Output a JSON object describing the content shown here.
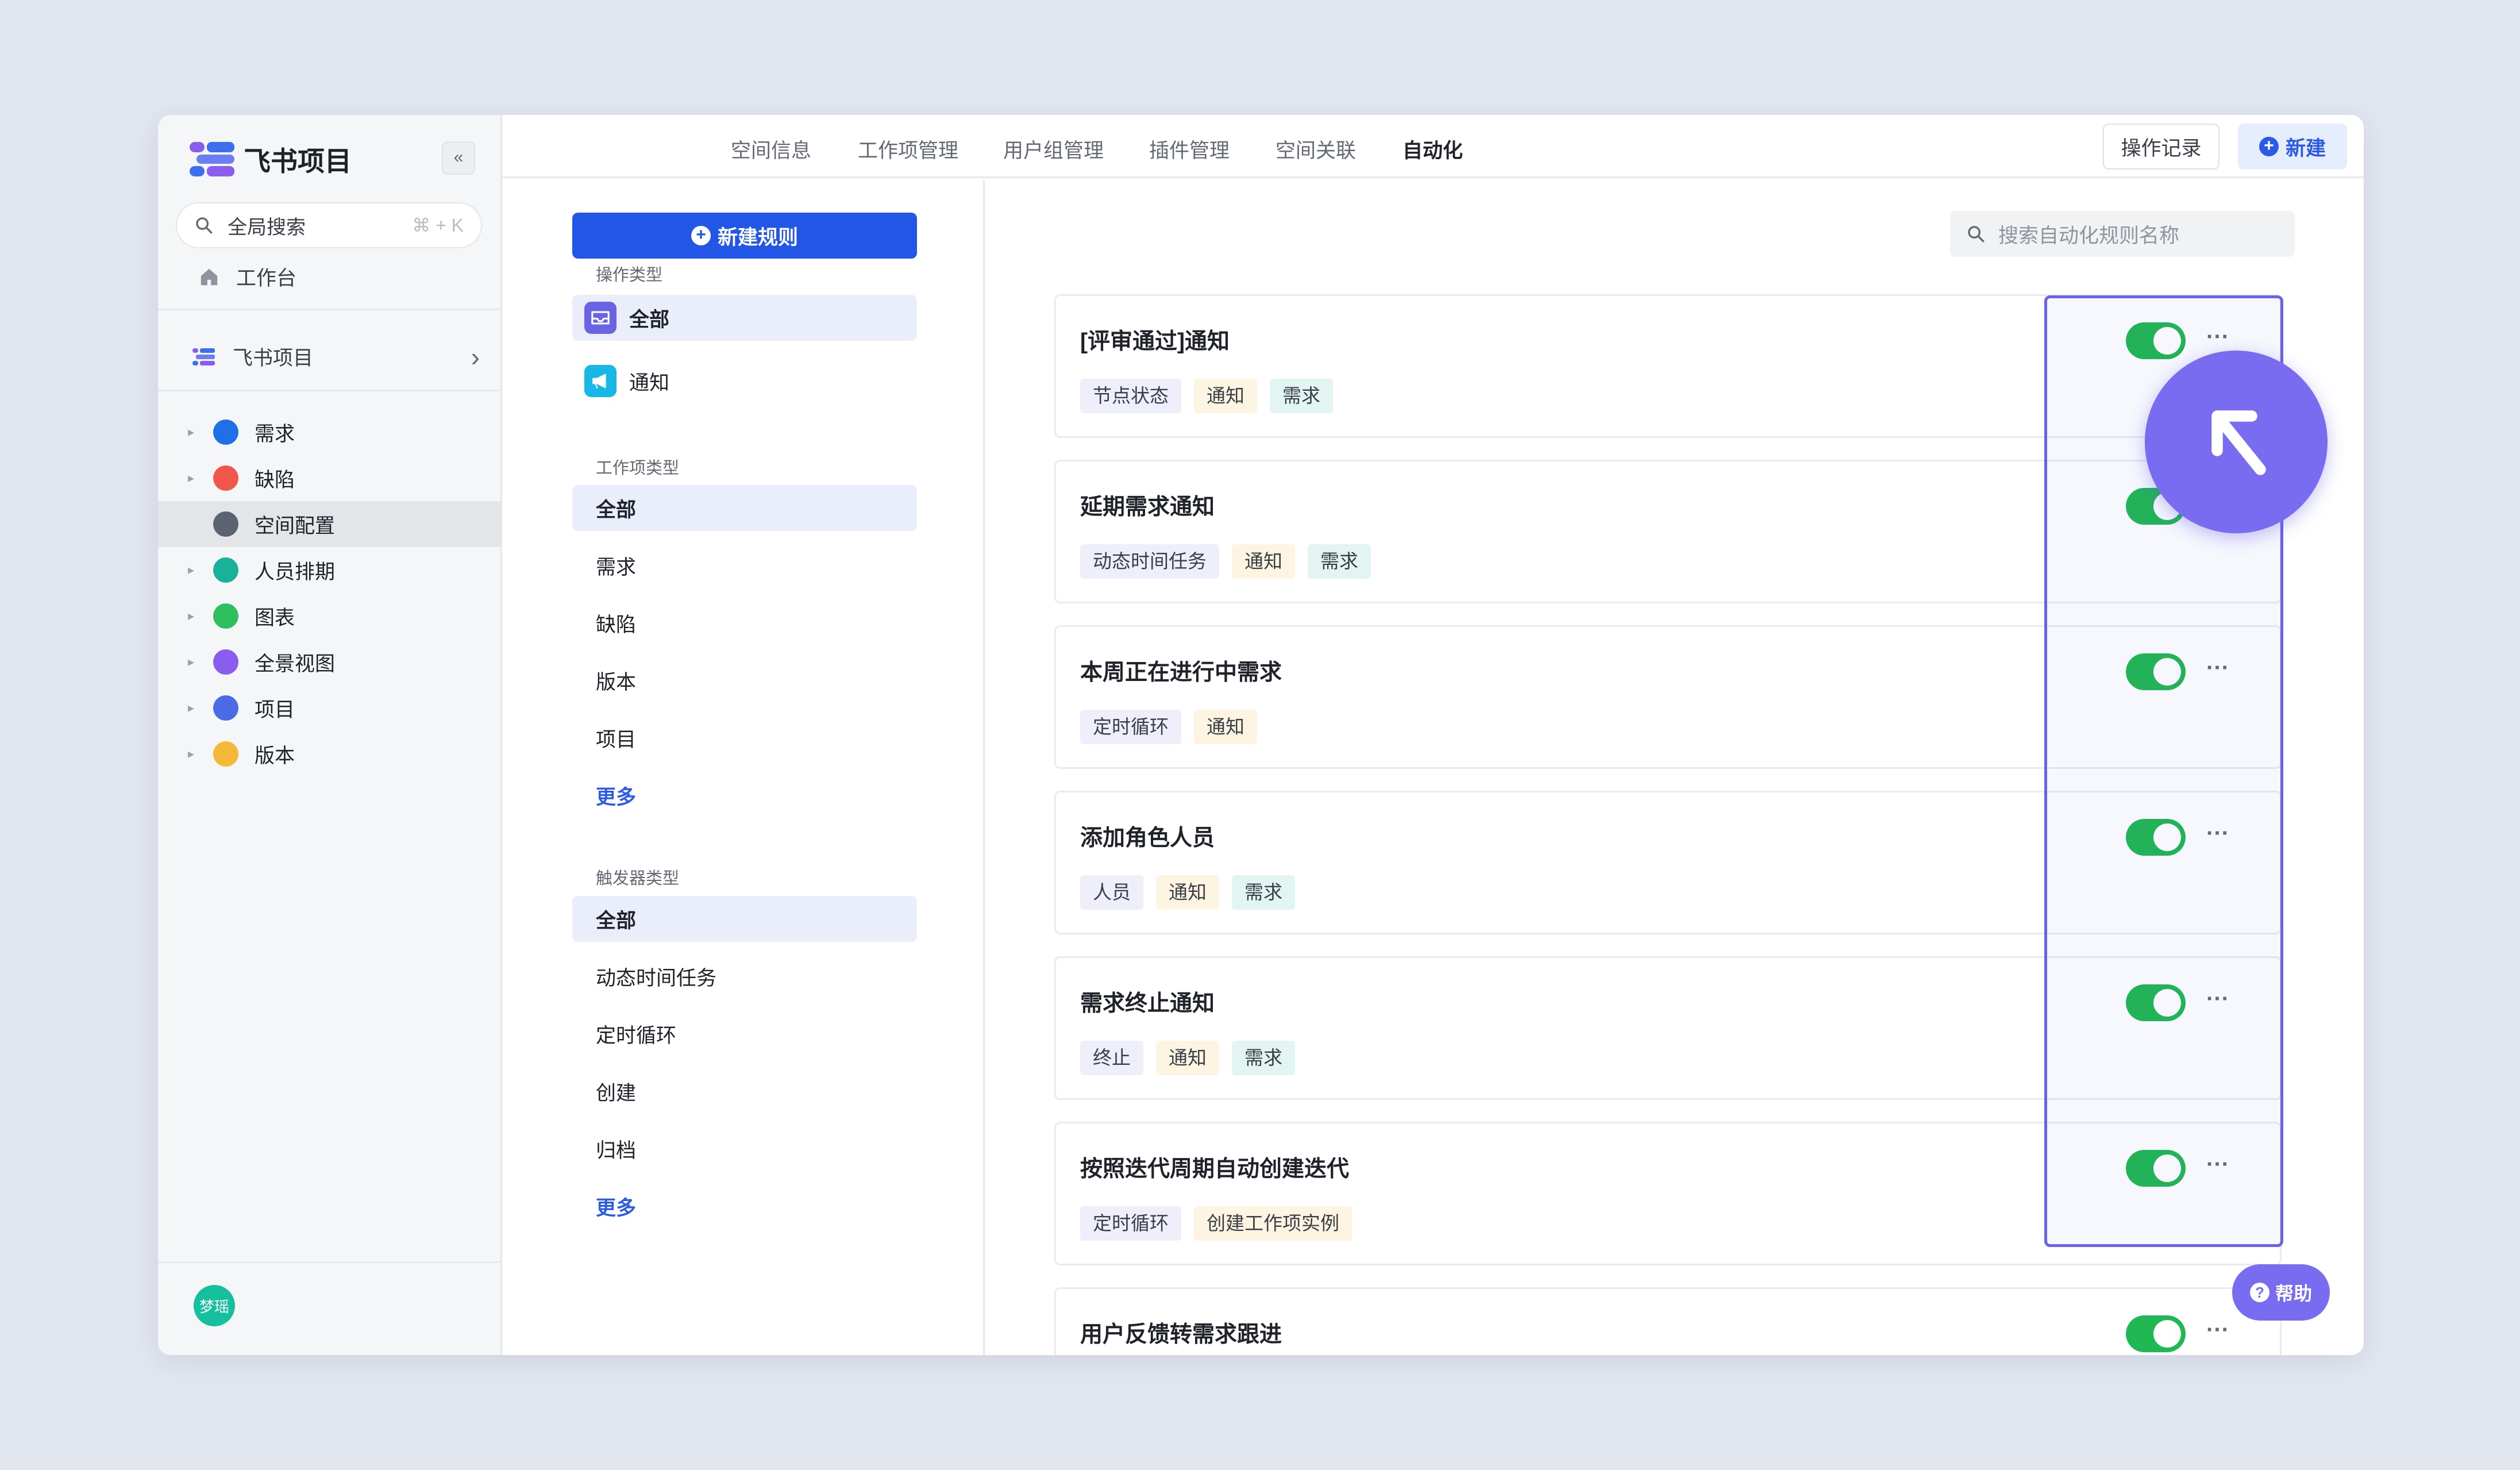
{
  "app": {
    "title": "飞书项目"
  },
  "sidebar": {
    "search_label": "全局搜索",
    "search_shortcut": "⌘ + K",
    "workbench": "工作台",
    "project_name": "飞书项目",
    "items": [
      {
        "label": "需求",
        "icon": "check-circle-icon",
        "color": "#1f6fe6",
        "expandable": true,
        "active": false
      },
      {
        "label": "缺陷",
        "icon": "alert-circle-icon",
        "color": "#f0564a",
        "expandable": true,
        "active": false
      },
      {
        "label": "空间配置",
        "icon": "list-settings-icon",
        "color": "#5b6270",
        "expandable": false,
        "active": true
      },
      {
        "label": "人员排期",
        "icon": "calendar-grid-icon",
        "color": "#18b29a",
        "expandable": true,
        "active": false
      },
      {
        "label": "图表",
        "icon": "bar-chart-icon",
        "color": "#2fbf5e",
        "expandable": true,
        "active": false
      },
      {
        "label": "全景视图",
        "icon": "panorama-icon",
        "color": "#8a5cf0",
        "expandable": true,
        "active": false
      },
      {
        "label": "项目",
        "icon": "folder-icon",
        "color": "#4a6be3",
        "expandable": true,
        "active": false
      },
      {
        "label": "版本",
        "icon": "version-icon",
        "color": "#f5b93a",
        "expandable": true,
        "active": false
      }
    ],
    "user_avatar": "梦瑶"
  },
  "header": {
    "tabs": [
      "空间信息",
      "工作项管理",
      "用户组管理",
      "插件管理",
      "空间关联",
      "自动化"
    ],
    "active_tab": "自动化",
    "log_button": "操作记录",
    "new_button": "新建"
  },
  "filters": {
    "new_rule_button": "新建规则",
    "operation_type": {
      "title": "操作类型",
      "items": [
        "全部",
        "通知"
      ]
    },
    "work_item_type": {
      "title": "工作项类型",
      "items": [
        "全部",
        "需求",
        "缺陷",
        "版本",
        "项目"
      ],
      "more": "更多"
    },
    "trigger_type": {
      "title": "触发器类型",
      "items": [
        "全部",
        "动态时间任务",
        "定时循环",
        "创建",
        "归档"
      ],
      "more": "更多"
    }
  },
  "rules": {
    "search_placeholder": "搜索自动化规则名称",
    "items": [
      {
        "title": "[评审通过]通知",
        "tags": [
          "节点状态",
          "通知",
          "需求"
        ],
        "enabled": true
      },
      {
        "title": "延期需求通知",
        "tags": [
          "动态时间任务",
          "通知",
          "需求"
        ],
        "enabled": true
      },
      {
        "title": "本周正在进行中需求",
        "tags": [
          "定时循环",
          "通知"
        ],
        "enabled": true
      },
      {
        "title": "添加角色人员",
        "tags": [
          "人员",
          "通知",
          "需求"
        ],
        "enabled": true
      },
      {
        "title": "需求终止通知",
        "tags": [
          "终止",
          "通知",
          "需求"
        ],
        "enabled": true
      },
      {
        "title": "按照迭代周期自动创建迭代",
        "tags": [
          "定时循环",
          "创建工作项实例"
        ],
        "enabled": true
      },
      {
        "title": "用户反馈转需求跟进",
        "tags": [],
        "enabled": true
      }
    ]
  },
  "help": {
    "label": "帮助"
  },
  "colors": {
    "accent": "#2256e6",
    "toggle_on": "#1fb852",
    "highlight": "#6b63e6",
    "cursor": "#7a6cf0"
  }
}
